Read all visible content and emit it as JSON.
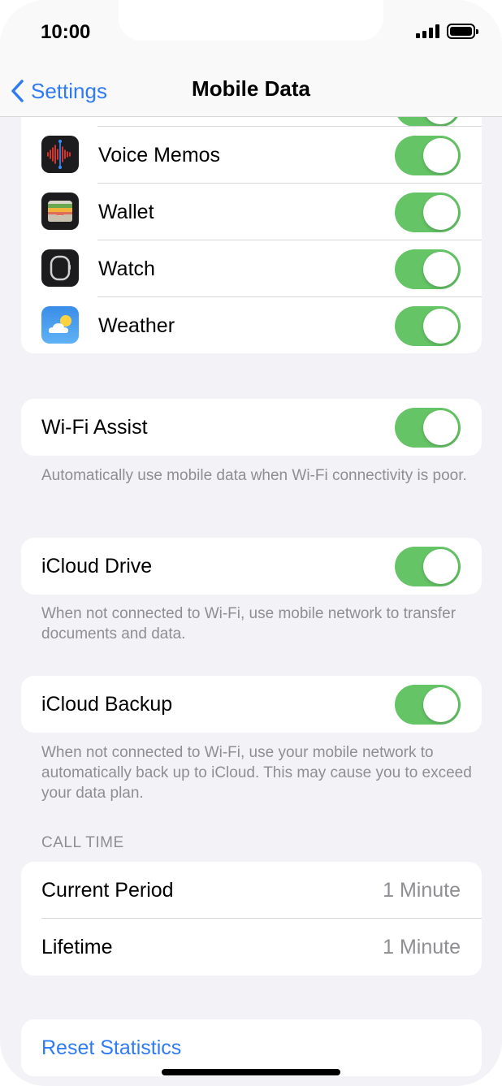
{
  "status_bar": {
    "time": "10:00"
  },
  "navbar": {
    "back_label": "Settings",
    "title": "Mobile Data"
  },
  "apps": [
    {
      "name": "Voice Memos",
      "icon": "voice-memos-icon",
      "enabled": true
    },
    {
      "name": "Wallet",
      "icon": "wallet-icon",
      "enabled": true
    },
    {
      "name": "Watch",
      "icon": "watch-icon",
      "enabled": true
    },
    {
      "name": "Weather",
      "icon": "weather-icon",
      "enabled": true
    }
  ],
  "wifi_assist": {
    "label": "Wi-Fi Assist",
    "enabled": true,
    "footer": "Automatically use mobile data when Wi-Fi connectivity is poor."
  },
  "icloud_drive": {
    "label": "iCloud Drive",
    "enabled": true,
    "footer": "When not connected to Wi-Fi, use mobile network to transfer documents and data."
  },
  "icloud_backup": {
    "label": "iCloud Backup",
    "enabled": true,
    "footer": "When not connected to Wi-Fi, use your mobile network to automatically back up to iCloud. This may cause you to exceed your data plan."
  },
  "call_time": {
    "header": "CALL TIME",
    "rows": [
      {
        "label": "Current Period",
        "value": "1 Minute"
      },
      {
        "label": "Lifetime",
        "value": "1 Minute"
      }
    ]
  },
  "reset": {
    "label": "Reset Statistics"
  },
  "colors": {
    "accent": "#2f7bf5",
    "toggle_on": "#65c466",
    "background": "#f2f2f7"
  }
}
